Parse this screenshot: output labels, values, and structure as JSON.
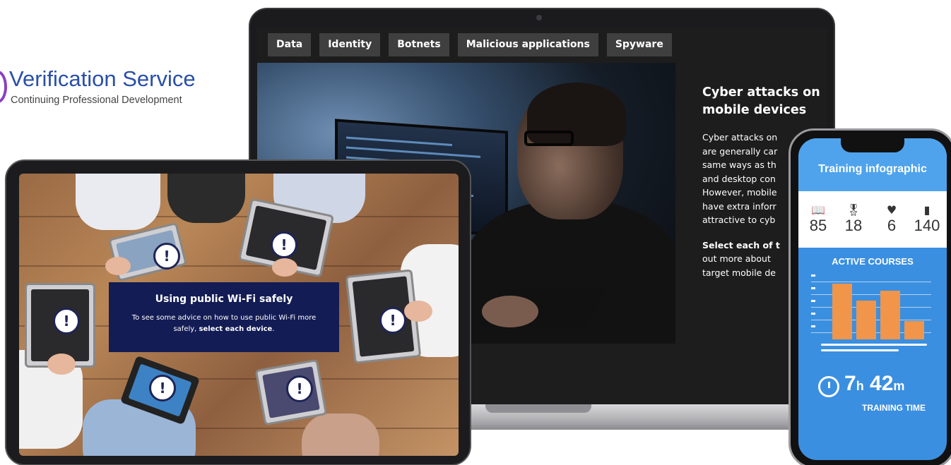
{
  "brand": {
    "title": "Verification Service",
    "subtitle": "Continuing Professional Development",
    "color": "#2a4fa8"
  },
  "laptop": {
    "tabs": [
      {
        "label": "Data"
      },
      {
        "label": "Identity"
      },
      {
        "label": "Botnets"
      },
      {
        "label": "Malicious applications"
      },
      {
        "label": "Spyware"
      }
    ],
    "side": {
      "title_line1": "Cyber attacks on",
      "title_line2": "mobile devices",
      "body_lines": [
        "Cyber attacks on",
        "are generally car",
        "same ways as th",
        "and desktop con",
        "However, mobile",
        "have extra inforr",
        "attractive to cyb"
      ],
      "cta_bold": "Select each of t",
      "cta_lines": [
        "out more about",
        "target mobile de"
      ]
    }
  },
  "tablet": {
    "title": "Using public Wi-Fi safely",
    "body_prefix": "To see some advice on how to use public Wi-Fi more safely, ",
    "body_bold": "select each device",
    "body_suffix": ".",
    "alert_glyph": "!",
    "box_color": "#131c54"
  },
  "phone": {
    "title": "Training infographic",
    "stats": [
      {
        "icon": "book-icon",
        "value": "85"
      },
      {
        "icon": "award-icon",
        "value": "18"
      },
      {
        "icon": "shield-icon",
        "value": "6"
      },
      {
        "icon": "bar-chart-icon",
        "value": "140"
      }
    ],
    "active_label": "ACTIVE COURSES",
    "chart_levels": [
      0.9,
      0.62,
      0.78,
      0.3
    ],
    "time_hours": "7",
    "time_h_unit": "h",
    "time_minutes": "42",
    "time_m_unit": "m",
    "time_label": "TRAINING TIME",
    "accent": "#3b8fe0",
    "bar_color": "#f0954a"
  }
}
